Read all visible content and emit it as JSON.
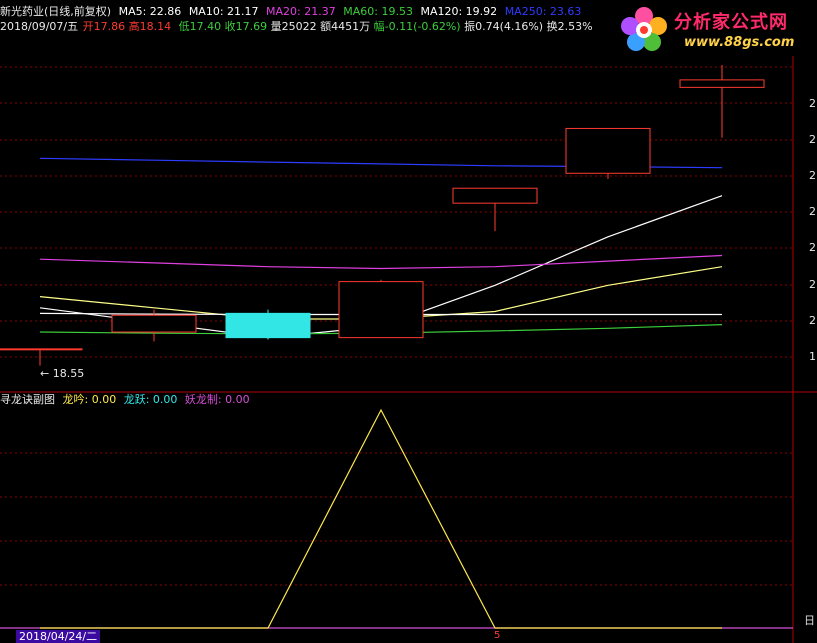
{
  "header": {
    "stock_label": "新光药业(日线,前复权)",
    "ma": [
      {
        "label": "MA5: 22.86",
        "color": "#ffffff"
      },
      {
        "label": "MA10: 21.17",
        "color": "#ffffff"
      },
      {
        "label": "MA20: 21.37",
        "color": "#e040e0"
      },
      {
        "label": "MA60: 19.53",
        "color": "#3ccd3c"
      },
      {
        "label": "MA120: 19.92",
        "color": "#ffffff"
      },
      {
        "label": "MA250: 23.63",
        "color": "#2e3cff"
      }
    ],
    "date": "2018/09/07/五",
    "quote": [
      {
        "label": "开17.86",
        "color": "#ff3b30"
      },
      {
        "label": "高18.14",
        "color": "#ff3b30"
      },
      {
        "label": "低17.40",
        "color": "#3ccd3c"
      },
      {
        "label": "收17.69",
        "color": "#3ccd3c"
      },
      {
        "label": "量25022",
        "color": "#e8e8e8"
      },
      {
        "label": "额4451万",
        "color": "#e8e8e8"
      },
      {
        "label": "幅-0.11(-0.62%)",
        "color": "#3ccd3c"
      },
      {
        "label": "振0.74(4.16%)",
        "color": "#e8e8e8"
      },
      {
        "label": "换2.53%",
        "color": "#e8e8e8"
      }
    ]
  },
  "logo": {
    "name": "分析家公式网",
    "url": "www.88gs.com"
  },
  "price_marker": "← 18.55",
  "sub_header": [
    {
      "label": "寻龙诀副图",
      "color": "#e8e8e8"
    },
    {
      "label": "龙吟: 0.00",
      "color": "#ffe94a"
    },
    {
      "label": "龙跃: 0.00",
      "color": "#33e6e6"
    },
    {
      "label": "妖龙制: 0.00",
      "color": "#d64fd6"
    }
  ],
  "right_axis_labels": [
    "2",
    "2",
    "2",
    "2",
    "2",
    "2",
    "2",
    "1"
  ],
  "bottom": {
    "date_box": "2018/04/24/二",
    "tick": "5",
    "right_tag": "日"
  },
  "chart_data": [
    {
      "type": "candlestick",
      "title": "新光药业(日线,前复权)",
      "candles": [
        {
          "open": 19.0,
          "close": 19.0,
          "high": 19.0,
          "low": 18.55,
          "color": "red"
        },
        {
          "open": 19.45,
          "close": 19.9,
          "high": 20.05,
          "low": 19.2,
          "color": "red"
        },
        {
          "open": 19.95,
          "close": 19.3,
          "high": 20.05,
          "low": 19.25,
          "color": "cyan"
        },
        {
          "open": 19.3,
          "close": 20.8,
          "high": 20.85,
          "low": 19.3,
          "color": "red"
        },
        {
          "open": 22.9,
          "close": 23.3,
          "high": 23.3,
          "low": 22.15,
          "color": "red"
        },
        {
          "open": 23.7,
          "close": 24.9,
          "high": 24.9,
          "low": 23.55,
          "color": "red"
        },
        {
          "open": 26.0,
          "close": 26.2,
          "high": 26.6,
          "low": 24.65,
          "color": "red"
        }
      ],
      "ma_series": [
        {
          "name": "MA5",
          "color": "#ffffff",
          "values": [
            20.1,
            19.7,
            19.3,
            19.6,
            20.7,
            22.0,
            23.1
          ]
        },
        {
          "name": "MA10",
          "color": "#ffff88",
          "values": [
            20.4,
            20.1,
            19.8,
            19.8,
            20.0,
            20.7,
            21.2
          ]
        },
        {
          "name": "MA20",
          "color": "#e040e0",
          "values": [
            21.4,
            21.3,
            21.2,
            21.15,
            21.2,
            21.35,
            21.5
          ]
        },
        {
          "name": "MA60",
          "color": "#3ccd3c",
          "values": [
            19.45,
            19.42,
            19.4,
            19.42,
            19.48,
            19.55,
            19.65
          ]
        },
        {
          "name": "MA120",
          "color": "#ffffff",
          "values": [
            19.95,
            19.93,
            19.92,
            19.92,
            19.92,
            19.92,
            19.92
          ]
        },
        {
          "name": "MA250",
          "color": "#2e3cff",
          "values": [
            24.1,
            24.05,
            24.0,
            23.95,
            23.9,
            23.88,
            23.85
          ]
        }
      ],
      "grid": true
    },
    {
      "type": "line",
      "title": "寻龙诀副图",
      "series": [
        {
          "name": "龙吟",
          "color": "#ffe94a",
          "values": [
            0,
            0,
            0,
            1,
            0,
            0,
            0
          ]
        }
      ],
      "ylim": [
        0,
        1
      ]
    }
  ]
}
